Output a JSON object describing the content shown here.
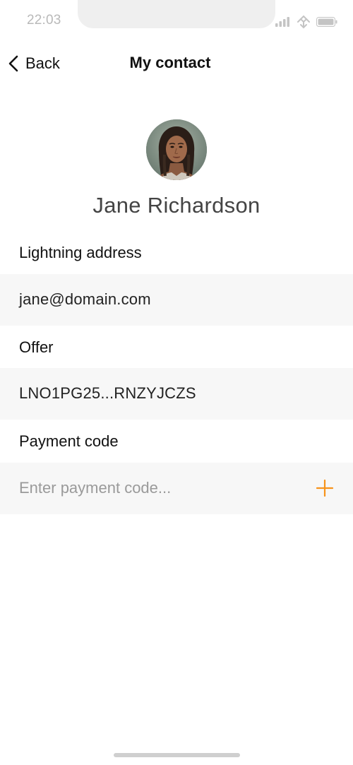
{
  "status_bar": {
    "time": "22:03",
    "icons": [
      "signal-icon",
      "wifi-icon",
      "battery-icon"
    ]
  },
  "nav": {
    "back_label": "Back",
    "title": "My contact"
  },
  "contact": {
    "name": "Jane Richardson",
    "avatar_icon": "avatar-photo"
  },
  "fields": {
    "lightning": {
      "label": "Lightning address",
      "value": "jane@domain.com"
    },
    "offer": {
      "label": "Offer",
      "value": "LNO1PG25...RNZYJCZS"
    },
    "payment_code": {
      "label": "Payment code",
      "value": "",
      "placeholder": "Enter payment code...",
      "add_icon": "plus-icon"
    }
  },
  "colors": {
    "accent": "#f7931a",
    "field_background": "#f7f7f7",
    "placeholder": "#9a9a9a",
    "muted_status": "#b9b9b9"
  }
}
